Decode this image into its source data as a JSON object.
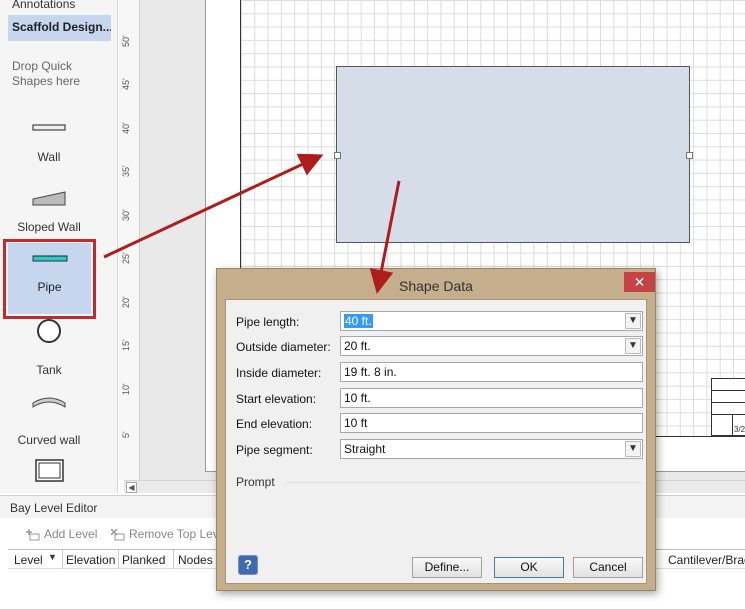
{
  "stencil": {
    "annotations_label": "Annotations",
    "active_stencil": "Scaffold Design...",
    "drop_hint_line1": "Drop Quick",
    "drop_hint_line2": "Shapes here",
    "shapes": [
      {
        "label": "Wall",
        "icon": "wall-icon"
      },
      {
        "label": "Sloped Wall",
        "icon": "sloped-wall-icon"
      },
      {
        "label": "Pipe",
        "icon": "pipe-icon"
      },
      {
        "label": "Tank",
        "icon": "tank-icon"
      },
      {
        "label": "Curved wall",
        "icon": "curved-wall-icon"
      },
      {
        "label": "",
        "icon": "frame-icon"
      }
    ]
  },
  "ruler": {
    "ticks": [
      "50'",
      "45'",
      "40'",
      "35'",
      "30'",
      "25'",
      "20'",
      "15'",
      "10'",
      "5'"
    ]
  },
  "title_block": {
    "date_fragment": "3/2"
  },
  "bay_editor": {
    "title": "Bay Level Editor",
    "add_level": "Add Level",
    "remove_top_level": "Remove Top Lev",
    "columns": [
      "Level",
      "Elevation",
      "Planked",
      "Nodes in",
      "Cantilever/Brack"
    ]
  },
  "dialog": {
    "title": "Shape Data",
    "close_glyph": "✕",
    "fields": {
      "pipe_length": {
        "label": "Pipe length:",
        "value": "40 ft."
      },
      "outside_diameter": {
        "label": "Outside diameter:",
        "value": "20 ft."
      },
      "inside_diameter": {
        "label": "Inside diameter:",
        "value": "19 ft. 8 in."
      },
      "start_elevation": {
        "label": "Start elevation:",
        "value": "10 ft."
      },
      "end_elevation": {
        "label": "End elevation:",
        "value": "10 ft"
      },
      "pipe_segment": {
        "label": "Pipe segment:",
        "value": "Straight"
      }
    },
    "prompt_label": "Prompt",
    "help_glyph": "?",
    "define_button": "Define...",
    "ok_button": "OK",
    "cancel_button": "Cancel"
  },
  "colors": {
    "highlight": "#c22b2b",
    "dialog_frame": "#c4ae8c",
    "close_button": "#c74242",
    "shape_fill": "#d4dde8",
    "selected_stencil": "#c7d6ef"
  }
}
